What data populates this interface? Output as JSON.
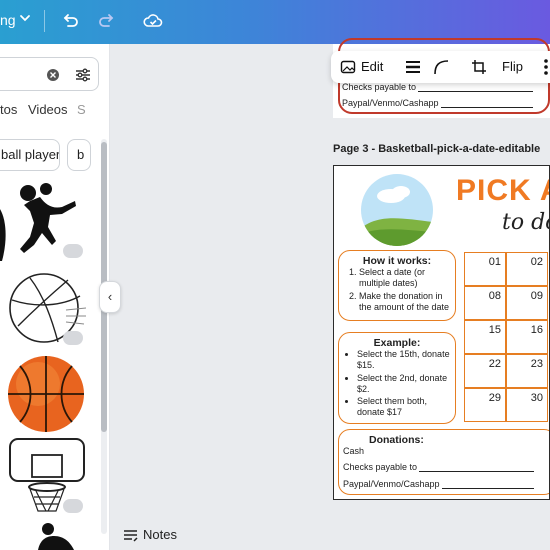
{
  "topbar": {
    "file_name_fragment": "ng",
    "icons": [
      "chevron-down-icon",
      "undo-icon",
      "redo-icon",
      "cloud-saved-icon"
    ],
    "accent_start": "#2a9fd1",
    "accent_end": "#6a5ae0"
  },
  "panel": {
    "search": {
      "value": "",
      "icons": [
        "clear-search-icon",
        "filter-icon"
      ]
    },
    "tabs": [
      "tos",
      "Videos",
      "S"
    ],
    "chips": [
      "ball player",
      "b"
    ],
    "graphics": [
      "basketball-player-dunk-silhouette",
      "basketball-line-art",
      "orange-basketball",
      "basketball-hoop",
      "basketball-players-silhouette"
    ],
    "premium_badge_icon": "crown-icon",
    "collapse_icon": "chevron-left-icon"
  },
  "canvas": {
    "prev_page": {
      "checks_label": "Checks payable to",
      "paypal_label": "Paypal/Venmo/Cashapp"
    },
    "float_toolbar": {
      "edit_label": "Edit",
      "flip_label": "Flip",
      "icons": [
        "edit-image-icon",
        "border-style-icon",
        "corner-rounding-icon",
        "crop-icon",
        "more-icon"
      ]
    },
    "page_title": "Page 3 - Basketball-pick-a-date-editable",
    "page": {
      "heading": "PICK A",
      "subheading": "to do",
      "how_it_works": {
        "title": "How it works:",
        "steps": [
          "Select a date (or multiple dates)",
          "Make the donation in the amount of the date"
        ]
      },
      "example": {
        "title": "Example:",
        "items": [
          "Select the 15th, donate $15.",
          "Select the 2nd, donate $2.",
          "Select them both, donate $17"
        ]
      },
      "donations": {
        "title": "Donations:",
        "cash_label": "Cash",
        "checks_label": "Checks payable to",
        "paypal_label": "Paypal/Venmo/Cashapp"
      },
      "dates": [
        "01",
        "02",
        "08",
        "09",
        "15",
        "16",
        "22",
        "23",
        "29",
        "30"
      ],
      "accent": "#f07a23"
    }
  },
  "footer": {
    "notes_label": "Notes",
    "notes_icon": "notes-icon"
  }
}
